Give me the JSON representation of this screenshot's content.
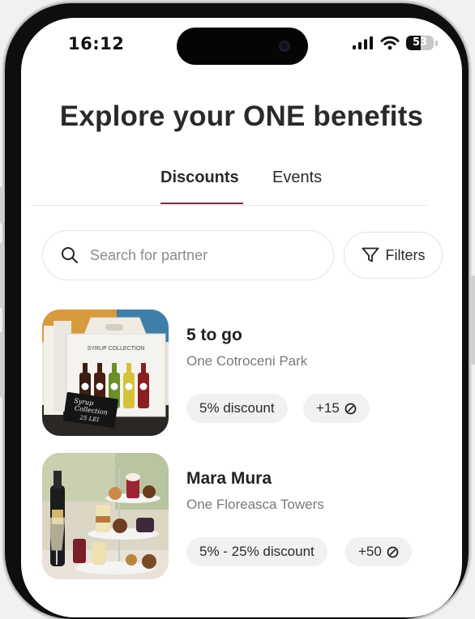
{
  "status_bar": {
    "time": "16:12",
    "battery": "53",
    "battery_level": 0.53
  },
  "page": {
    "title": "Explore your ONE benefits"
  },
  "tabs": [
    {
      "label": "Discounts",
      "active": true
    },
    {
      "label": "Events",
      "active": false
    }
  ],
  "search": {
    "placeholder": "Search for partner",
    "value": ""
  },
  "filters": {
    "label": "Filters"
  },
  "partners": [
    {
      "name": "5 to go",
      "location": "One Cotroceni Park",
      "discount": "5% discount",
      "points": "+15",
      "image": "syrup-collection-photo",
      "image_text": {
        "box": "SYRUP COLLECTION",
        "sign_line1": "Syrup",
        "sign_line2": "Collection",
        "sign_line3": "25 LEI",
        "bottle": "5"
      }
    },
    {
      "name": "Mara Mura",
      "location": "One Floreasca Towers",
      "discount": "5% - 25% discount",
      "points": "+50",
      "image": "dessert-stand-photo"
    }
  ],
  "colors": {
    "accent": "#7a2a45",
    "text": "#2a2a2a",
    "muted": "#7a7a7a",
    "pill_bg": "#f1f1f1"
  },
  "icons": {
    "search": "search-icon",
    "filters": "funnel-icon",
    "points": "coin-icon",
    "signal": "signal-icon",
    "wifi": "wifi-icon",
    "battery": "battery-icon"
  }
}
